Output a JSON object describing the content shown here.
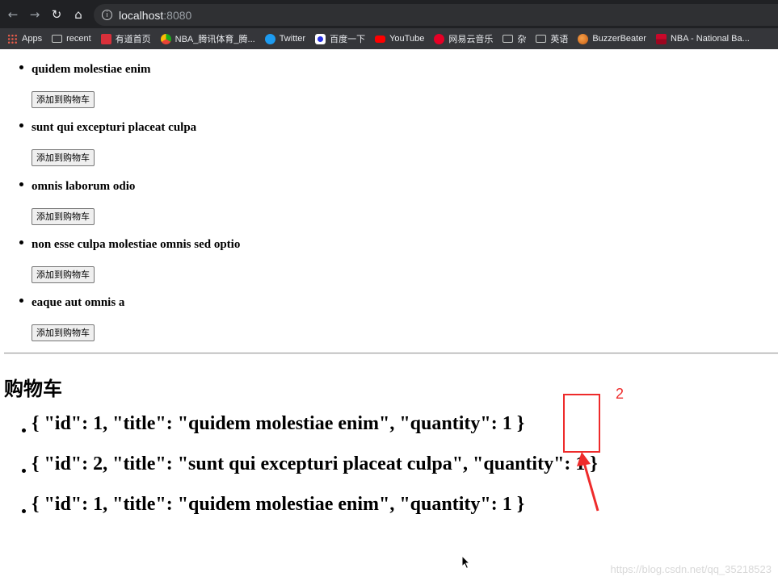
{
  "browser": {
    "url_host": "localhost",
    "url_port": ":8080",
    "bookmarks": [
      {
        "label": "Apps",
        "icon": "apps-icon"
      },
      {
        "label": "recent",
        "icon": "folder-icon"
      },
      {
        "label": "有道首页",
        "icon": "youdao-icon"
      },
      {
        "label": "NBA_腾讯体育_腾...",
        "icon": "tencent-sports-icon"
      },
      {
        "label": "Twitter",
        "icon": "twitter-icon"
      },
      {
        "label": "百度一下",
        "icon": "baidu-icon"
      },
      {
        "label": "YouTube",
        "icon": "youtube-icon"
      },
      {
        "label": "网易云音乐",
        "icon": "netease-music-icon"
      },
      {
        "label": "杂",
        "icon": "folder-icon"
      },
      {
        "label": "英语",
        "icon": "folder-icon"
      },
      {
        "label": "BuzzerBeater",
        "icon": "buzzerbeater-icon"
      },
      {
        "label": "NBA - National Ba...",
        "icon": "nba-icon"
      }
    ]
  },
  "products": [
    {
      "title": "quidem molestiae enim",
      "button": "添加到购物车"
    },
    {
      "title": "sunt qui excepturi placeat culpa",
      "button": "添加到购物车"
    },
    {
      "title": "omnis laborum odio",
      "button": "添加到购物车"
    },
    {
      "title": "non esse culpa molestiae omnis sed optio",
      "button": "添加到购物车"
    },
    {
      "title": "eaque aut omnis a",
      "button": "添加到购物车"
    }
  ],
  "cart": {
    "title": "购物车",
    "items": [
      {
        "text": "{ \"id\": 1, \"title\": \"quidem molestiae enim\", \"quantity\": 1 }"
      },
      {
        "text": "{ \"id\": 2, \"title\": \"sunt qui excepturi placeat culpa\", \"quantity\": 1 }"
      },
      {
        "text": "{ \"id\": 1, \"title\": \"quidem molestiae enim\", \"quantity\": 1 }"
      }
    ]
  },
  "annotation": {
    "number": "2",
    "color": "#ee2b2b"
  },
  "watermark": "https://blog.csdn.net/qq_35218523"
}
